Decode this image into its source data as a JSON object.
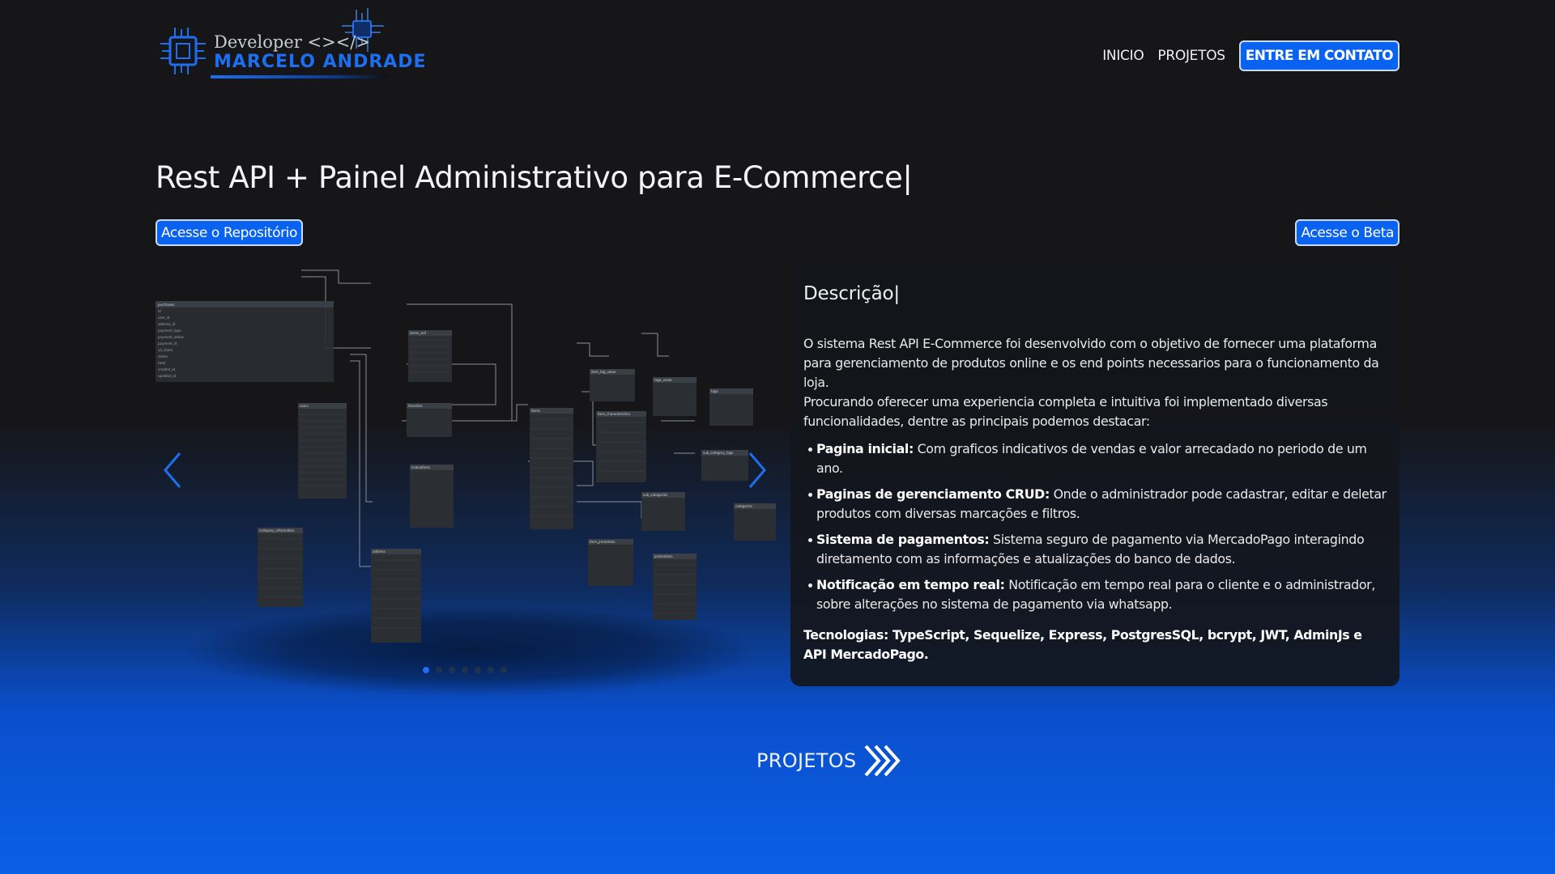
{
  "header": {
    "logo_developer": "Developer <></>",
    "logo_name": "MARCELO ANDRADE",
    "nav": {
      "home": "INICIO",
      "projects": "PROJETOS",
      "contact": "ENTRE EM CONTATO"
    }
  },
  "project": {
    "title": "Rest API + Painel Administrativo para E-Commerce|",
    "repo_button": "Acesse o Repositório",
    "beta_button": "Acesse o Beta"
  },
  "carousel": {
    "total_slides": 7,
    "active_slide": 1,
    "tables": [
      "purchases",
      "items_sell",
      "users",
      "favorites",
      "evaluations",
      "items",
      "item_characteristics",
      "item_tag_value",
      "tags_value",
      "tags",
      "sub_category_tags",
      "sub_categories",
      "categories",
      "item_promotion",
      "promotions",
      "company_information",
      "address"
    ]
  },
  "description": {
    "title": "Descrição|",
    "intro1": "O sistema Rest API E-Commerce foi desenvolvido com o objetivo de fornecer uma plataforma para gerenciamento de produtos online e os end points necessarios para o funcionamento da loja.",
    "intro2": "Procurando oferecer uma experiencia completa e intuitiva foi implementado diversas funcionalidades, dentre as principais podemos destacar:",
    "features": [
      {
        "title": "Pagina inicial:",
        "text": " Com graficos indicativos de vendas e valor arrecadado no periodo de um ano."
      },
      {
        "title": "Paginas de gerenciamento CRUD:",
        "text": " Onde o administrador pode cadastrar, editar e deletar produtos com diversas marcações e filtros."
      },
      {
        "title": "Sistema de pagamentos:",
        "text": " Sistema seguro de pagamento via MercadoPago interagindo diretamento com as informações e atualizações do banco de dados."
      },
      {
        "title": "Notificação em tempo real:",
        "text": " Notificação em tempo real para o cliente e o administrador, sobre alterações no sistema de pagamento via whatsapp."
      }
    ],
    "technologies": "Tecnologias: TypeScript, Sequelize, Express, PostgresSQL, bcrypt, JWT, AdminJs e API MercadoPago."
  },
  "footer_link": {
    "label": "PROJETOS"
  },
  "colors": {
    "accent": "#1d6ff2",
    "button_bg": "#0a63f0",
    "background_dark": "#161618",
    "background_blue": "#0a5fe6"
  }
}
